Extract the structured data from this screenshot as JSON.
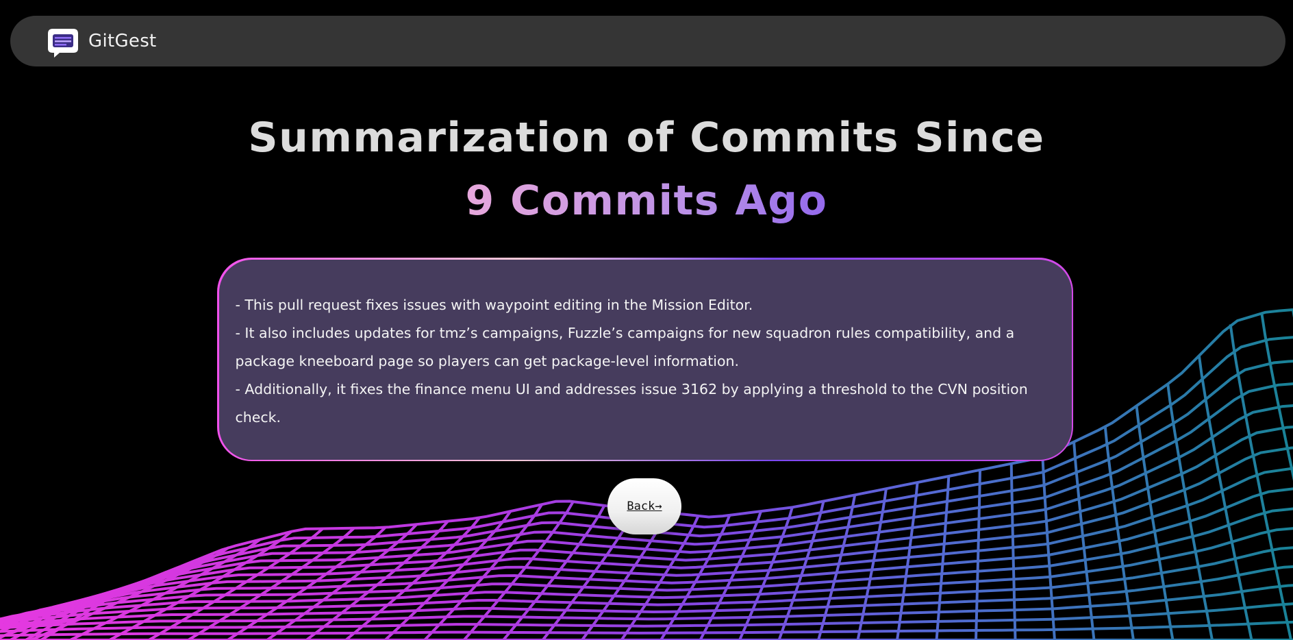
{
  "navbar": {
    "brand": "GitGest",
    "logo_icon": "chat-bubble-icon"
  },
  "heading": {
    "line1": "Summarization of Commits Since",
    "line2": "9 Commits Ago"
  },
  "summary": {
    "lines": [
      "- This pull request fixes issues with waypoint editing in the Mission Editor.",
      "- It also includes updates for tmz’s campaigns, Fuzzle’s campaigns for new squadron rules compatibility, and a",
      "package kneeboard page so players can get package-level information.",
      "- Additionally, it fixes the finance menu UI and addresses issue 3162 by applying a threshold to the CVN position",
      "check."
    ]
  },
  "back_button": {
    "label": "Back→"
  },
  "colors": {
    "background": "#000000",
    "navbar": "#353535",
    "card": "#463c5d",
    "gradient_pink": "#f23dec",
    "gradient_purple": "#6a3cf2",
    "wave_teal": "#1b8aa0"
  }
}
